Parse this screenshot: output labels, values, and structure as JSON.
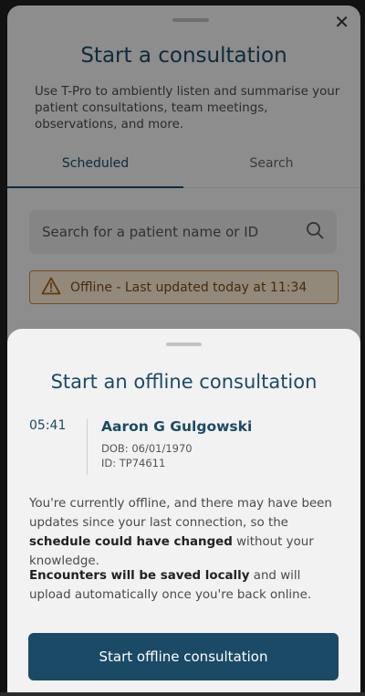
{
  "background": {
    "title": "Start a consultation",
    "description": "Use T-Pro to ambiently listen and summarise your patient consultations, team meetings, observations, and more.",
    "tabs": [
      {
        "label": "Scheduled"
      },
      {
        "label": "Search"
      }
    ],
    "search": {
      "placeholder": "Search for a patient name or ID"
    },
    "offline_banner": "Offline - Last updated today at 11:34",
    "close_glyph": "✕"
  },
  "sheet": {
    "title": "Start an offline consultation",
    "appointment": {
      "time": "05:41",
      "name": "Aaron G Gulgowski",
      "dob": "DOB: 06/01/1970",
      "id": "ID: TP74611"
    },
    "paragraph1": {
      "pre": "You're currently offline, and there may have been updates since your last connection, so the ",
      "bold": "schedule could have changed",
      "post": " without your knowledge."
    },
    "paragraph2": {
      "bold": "Encounters will be saved locally",
      "post": " and will upload automatically once you're back online."
    },
    "cta_label": "Start offline consultation"
  },
  "colors": {
    "primary": "#1b4a66",
    "warning_border": "#c7893b",
    "warning_bg": "#fbecd4"
  },
  "icons": [
    "close-icon",
    "search-icon",
    "warning-icon"
  ]
}
